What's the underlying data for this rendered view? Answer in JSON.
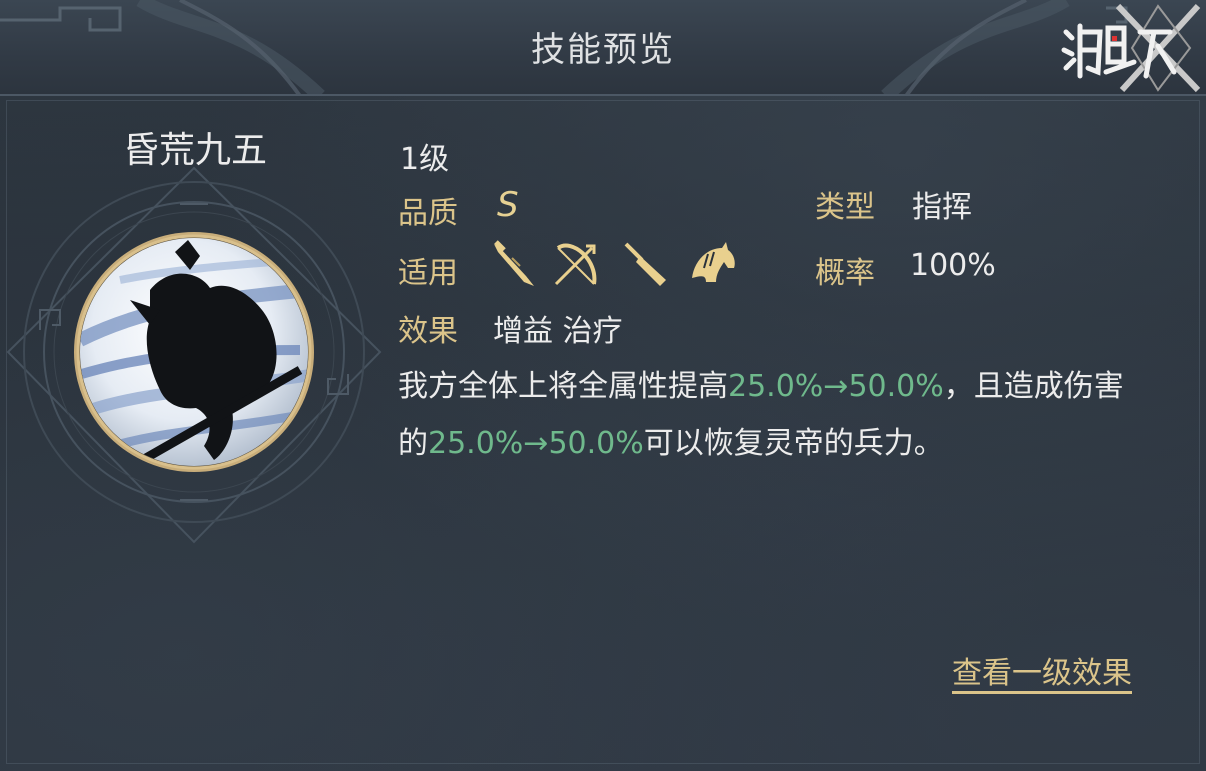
{
  "header": {
    "title": "技能预览",
    "logo_icon": "game-logo-emblem"
  },
  "skill": {
    "name": "昏荒九五",
    "level": "1级",
    "quality_label": "品质",
    "quality_value": "S",
    "type_label": "类型",
    "type_value": "指挥",
    "apply_label": "适用",
    "troop_icons": [
      "sword-icon",
      "bow-icon",
      "spear-icon",
      "cavalry-horse-icon"
    ],
    "rate_label": "概率",
    "rate_value": "100%",
    "effect_label": "效果",
    "effect_tags": "增益 治疗",
    "description": {
      "part1": "我方全体上将全属性提高",
      "value1": "25.0%→50.0%",
      "part2": "，且造成伤害的",
      "value2": "25.0%→50.0%",
      "part3": "可以恢复灵帝的兵力。"
    }
  },
  "footer": {
    "view_link": "查看一级效果"
  },
  "colors": {
    "gold": "#dbc48a",
    "green_value": "#6fb98c",
    "background": "#2a323b"
  }
}
